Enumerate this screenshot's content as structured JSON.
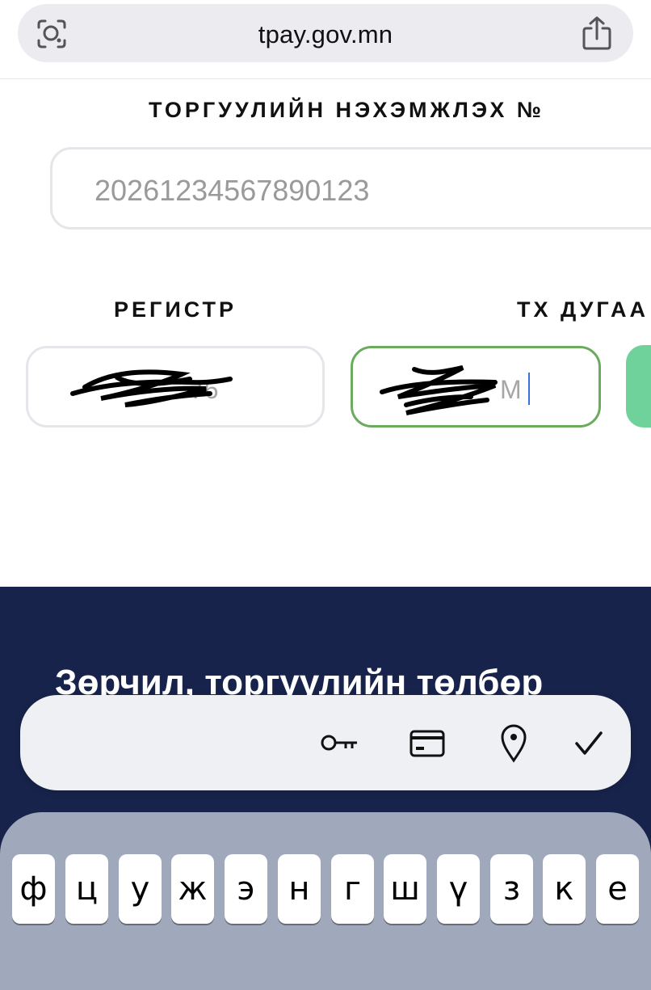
{
  "browser": {
    "url": "tpay.gov.mn"
  },
  "form": {
    "invoice_label": "ТОРГУУЛИЙН НЭХЭМЖЛЭХ №",
    "invoice_placeholder": "20261234567890123",
    "register_label": "РЕГИСТР",
    "register_value_visible": "76",
    "plate_label": "ТХ ДУГАА",
    "plate_value_visible": "М"
  },
  "footer": {
    "title": "Зөрчил, торгуулийн төлбөр"
  },
  "autofill_bar": {
    "icons": [
      "key-icon",
      "credit-card-icon",
      "location-pin-icon",
      "checkmark-icon"
    ]
  },
  "keyboard": {
    "row1": [
      "ф",
      "ц",
      "у",
      "ж",
      "э",
      "н",
      "г",
      "ш",
      "ү",
      "з",
      "к",
      "е"
    ]
  }
}
